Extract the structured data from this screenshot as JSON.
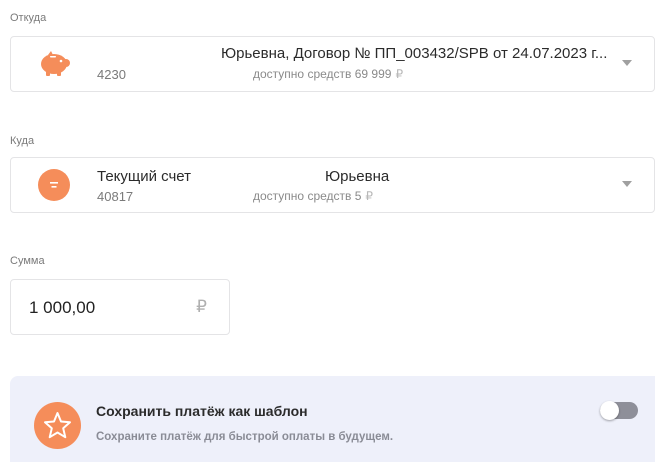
{
  "from": {
    "label": "Откуда",
    "number": "4230",
    "title": "Юрьевна, Договор № ПП_003432/SPB от 24.07.2023 г...",
    "available_text": "доступно средств 69 999",
    "currency": "₽",
    "icon": "piggy-bank-icon"
  },
  "to": {
    "label": "Куда",
    "name": "Текущий счет",
    "owner": "Юрьевна",
    "number": "40817",
    "available_text": "доступно средств 5",
    "currency": "₽",
    "icon": "ruble-coin-icon"
  },
  "amount": {
    "label": "Сумма",
    "value": "1 000,00",
    "currency": "₽"
  },
  "template": {
    "title": "Сохранить платёж как шаблон",
    "subtitle": "Сохраните платёж для быстрой оплаты в будущем.",
    "icon": "star-icon",
    "toggle_on": false
  },
  "colors": {
    "accent": "#f58d5a",
    "template_bg": "#eef0fa",
    "toggle_off": "#8e8f99"
  }
}
